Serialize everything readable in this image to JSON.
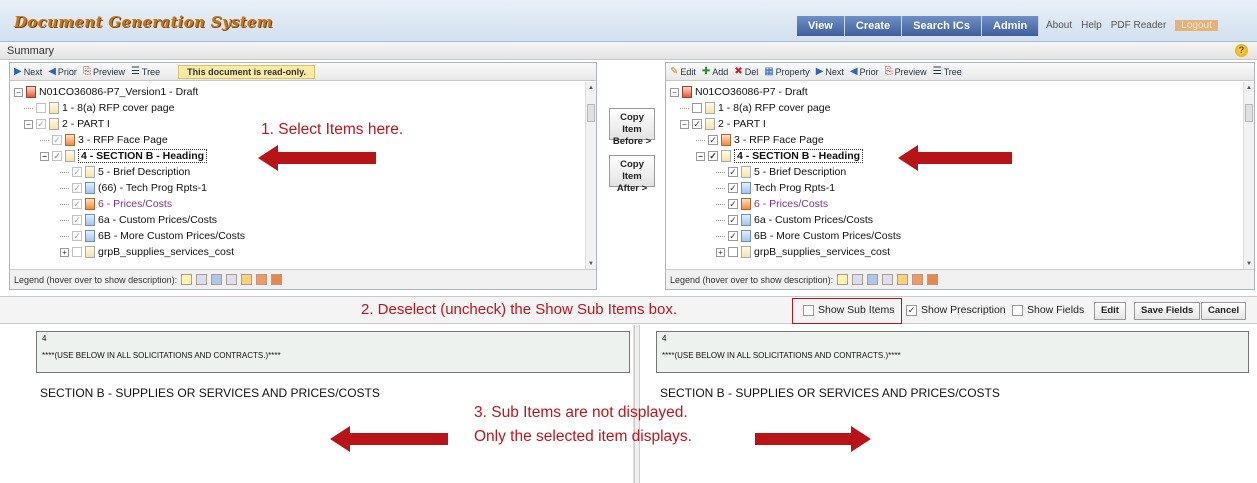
{
  "app": {
    "title": "Document Generation System"
  },
  "nav": {
    "tabs": [
      "View",
      "Create",
      "Search ICs",
      "Admin"
    ],
    "links": [
      "About",
      "Help",
      "PDF Reader",
      "Logout"
    ]
  },
  "summary": {
    "label": "Summary"
  },
  "left_panel": {
    "toolbar": [
      "Next",
      "Prior",
      "Preview",
      "Tree"
    ],
    "readonly_note": "This document is read-only.",
    "tree": [
      "N01CO36086-P7_Version1 - Draft",
      "1 - 8(a) RFP cover page",
      "2 - PART I",
      "3 - RFP Face Page",
      "4 - SECTION B - Heading",
      "5 - Brief Description",
      "(66) - Tech Prog Rpts-1",
      "6 - Prices/Costs",
      "6a - Custom Prices/Costs",
      "6B - More Custom Prices/Costs",
      "grpB_supplies_services_cost"
    ],
    "legend_label": "Legend (hover over to show description):"
  },
  "copy_buttons": {
    "before": [
      "Copy Item",
      "Before >"
    ],
    "after": [
      "Copy Item",
      "After >"
    ]
  },
  "right_panel": {
    "toolbar": [
      "Edit",
      "Add",
      "Del",
      "Property",
      "Next",
      "Prior",
      "Preview",
      "Tree"
    ],
    "tree": [
      "N01CO36086-P7 - Draft",
      "1 - 8(a) RFP cover page",
      "2 - PART I",
      "3 - RFP Face Page",
      "4 - SECTION B - Heading",
      "5 - Brief Description",
      "Tech Prog Rpts-1",
      "6 - Prices/Costs",
      "6a - Custom Prices/Costs",
      "6B - More Custom Prices/Costs",
      "grpB_supplies_services_cost"
    ],
    "legend_label": "Legend (hover over to show description):"
  },
  "annotations": {
    "step1": "1. Select Items here.",
    "step2": "2. Deselect (uncheck) the Show Sub Items box.",
    "step3_line1": "3. Sub Items are not displayed.",
    "step3_line2": "Only the selected item displays."
  },
  "options": {
    "show_sub_items": {
      "label": "Show Sub Items",
      "checked": false
    },
    "show_prescription": {
      "label": "Show Prescription",
      "checked": true
    },
    "show_fields": {
      "label": "Show Fields",
      "checked": false
    },
    "edit_label": "Edit",
    "save_fields_label": "Save Fields",
    "cancel_label": "Cancel"
  },
  "content": {
    "item_number": "4",
    "prescription": "****(USE BELOW IN ALL SOLICITATIONS AND CONTRACTS.)****",
    "section_title": "SECTION B - SUPPLIES OR SERVICES AND PRICES/COSTS"
  },
  "colors": {
    "accent_red": "#c0141b",
    "nav_blue": "#3e5f9c",
    "title_orange": "#c8751a",
    "selected_purple": "#7d2f9a"
  }
}
